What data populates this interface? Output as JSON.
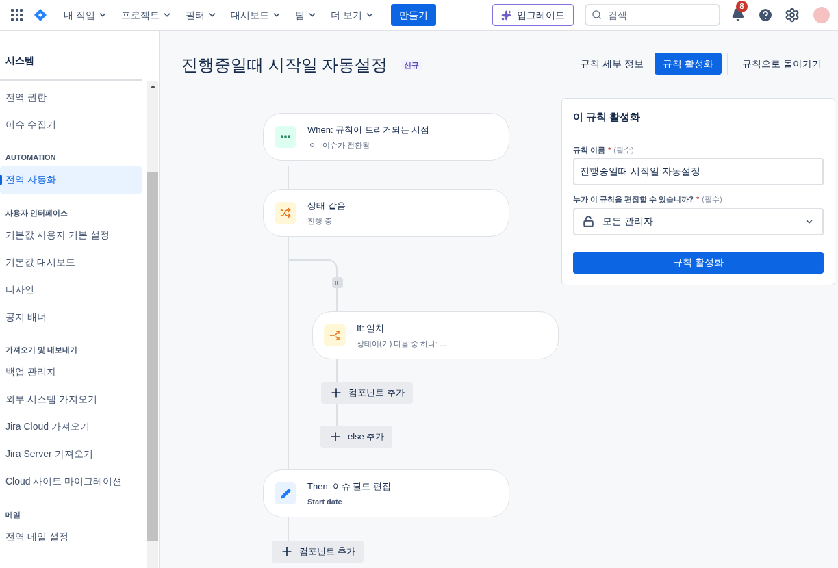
{
  "topnav": {
    "menus": [
      {
        "label": "내 작업"
      },
      {
        "label": "프로젝트"
      },
      {
        "label": "필터"
      },
      {
        "label": "대시보드"
      },
      {
        "label": "팀"
      },
      {
        "label": "더 보기"
      }
    ],
    "create_button": "만들기",
    "upgrade_button": "업그레이드",
    "search": {
      "placeholder": "검색"
    },
    "notification_count": "8"
  },
  "sidebar": {
    "title": "시스템",
    "items": [
      {
        "kind": "item",
        "label": "전역 권한",
        "selected": false
      },
      {
        "kind": "item",
        "label": "이슈 수집기",
        "selected": false
      },
      {
        "kind": "heading",
        "label": "AUTOMATION"
      },
      {
        "kind": "item",
        "label": "전역 자동화",
        "selected": true
      },
      {
        "kind": "heading",
        "label": "사용자 인터페이스"
      },
      {
        "kind": "item",
        "label": "기본값 사용자 기본 설정",
        "selected": false
      },
      {
        "kind": "item",
        "label": "기본값 대시보드",
        "selected": false
      },
      {
        "kind": "item",
        "label": "디자인",
        "selected": false
      },
      {
        "kind": "item",
        "label": "공지 배너",
        "selected": false
      },
      {
        "kind": "heading",
        "label": "가져오기 및 내보내기"
      },
      {
        "kind": "item",
        "label": "백업 관리자",
        "selected": false
      },
      {
        "kind": "item",
        "label": "외부 시스템 가져오기",
        "selected": false
      },
      {
        "kind": "item",
        "label": "Jira Cloud 가져오기",
        "selected": false
      },
      {
        "kind": "item",
        "label": "Jira Server 가져오기",
        "selected": false
      },
      {
        "kind": "item",
        "label": "Cloud 사이트 마이그레이션",
        "selected": false
      },
      {
        "kind": "heading",
        "label": "메일"
      },
      {
        "kind": "item",
        "label": "전역 메일 설정",
        "selected": false
      }
    ]
  },
  "page": {
    "title": "진행중일때 시작일 자동설정",
    "badge": "신규",
    "actions": [
      {
        "label": "규칙 세부 정보",
        "selected": false
      },
      {
        "label": "규칙 활성화",
        "selected": true
      },
      {
        "label": "규칙으로 돌아가기",
        "selected": false
      }
    ]
  },
  "flow": {
    "trigger": {
      "kind": "trigger",
      "title": "When: 규칙이 트리거되는 시점",
      "subtitle": "이슈가 전환됨"
    },
    "condition": {
      "kind": "condition",
      "title": "상태 같음",
      "subtitle": "진행 중"
    },
    "branch_label": "IF",
    "branch": {
      "kind": "branch",
      "title": "If: 일치",
      "subtitle": "상태이(가) 다음 중 하나: ..."
    },
    "branch_add": "컴포넌트 추가",
    "else_add": "else 추가",
    "action": {
      "kind": "action",
      "title": "Then: 이슈 필드 편집",
      "subtitle": "Start date"
    },
    "add": "컴포넌트 추가"
  },
  "panel": {
    "title": "이 규칙 활성화",
    "name_label": "규칙 이름",
    "name_asterisk": "*",
    "name_required": "(필수)",
    "name_value": "진행중일때 시작일 자동설정",
    "editor_label": "누가 이 규칙을 편집할 수 있습니까?",
    "editor_asterisk": "*",
    "editor_required": "(필수)",
    "editor_value": "모든 관리자",
    "submit": "규칙 활성화"
  }
}
